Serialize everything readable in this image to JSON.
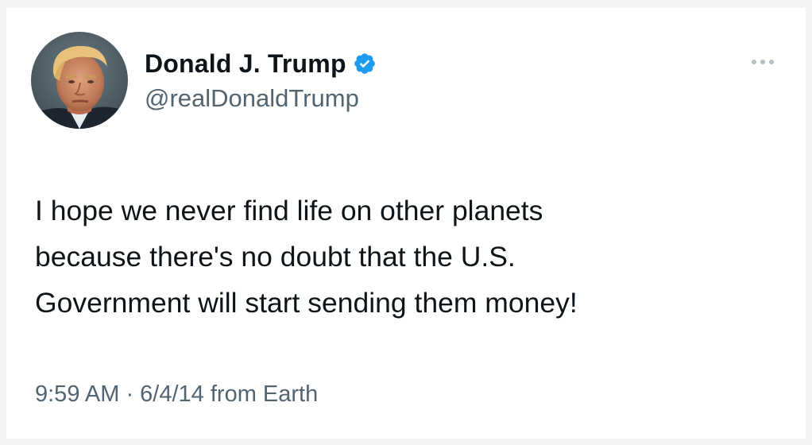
{
  "tweet": {
    "author": {
      "display_name": "Donald J. Trump",
      "handle": "@realDonaldTrump",
      "verified": true
    },
    "text_lines": [
      "I hope we never find life on other planets",
      "because there's no doubt that the U.S.",
      "Government will start sending them money!"
    ],
    "timestamp": "9:59 AM · 6/4/14 from Earth"
  },
  "colors": {
    "verified_badge": "#1d9bf0",
    "secondary_text": "#536471",
    "primary_text": "#0f1419"
  },
  "icons": {
    "verified": "verified-badge-icon",
    "more": "more-options-icon"
  }
}
